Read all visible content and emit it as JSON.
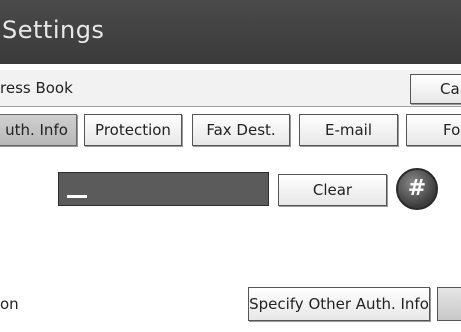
{
  "header": {
    "title": "Settings"
  },
  "subheader": {
    "breadcrumb": "ress Book",
    "cancel_label": "Car"
  },
  "tabs": [
    {
      "label": "uth. Info",
      "active": true
    },
    {
      "label": "Protection",
      "active": false
    },
    {
      "label": "Fax Dest.",
      "active": false
    },
    {
      "label": "E-mail",
      "active": false
    },
    {
      "label": "Fol",
      "active": false
    }
  ],
  "input": {
    "value": "_"
  },
  "buttons": {
    "clear_label": "Clear",
    "hash_label": "#",
    "specify_label": "Specify Other Auth. Info"
  },
  "footer": {
    "label": "on"
  },
  "colors": {
    "title_bar": "#3f3f3f",
    "input_background": "#5b5b5b",
    "active_tab": "#c4c4c4"
  }
}
